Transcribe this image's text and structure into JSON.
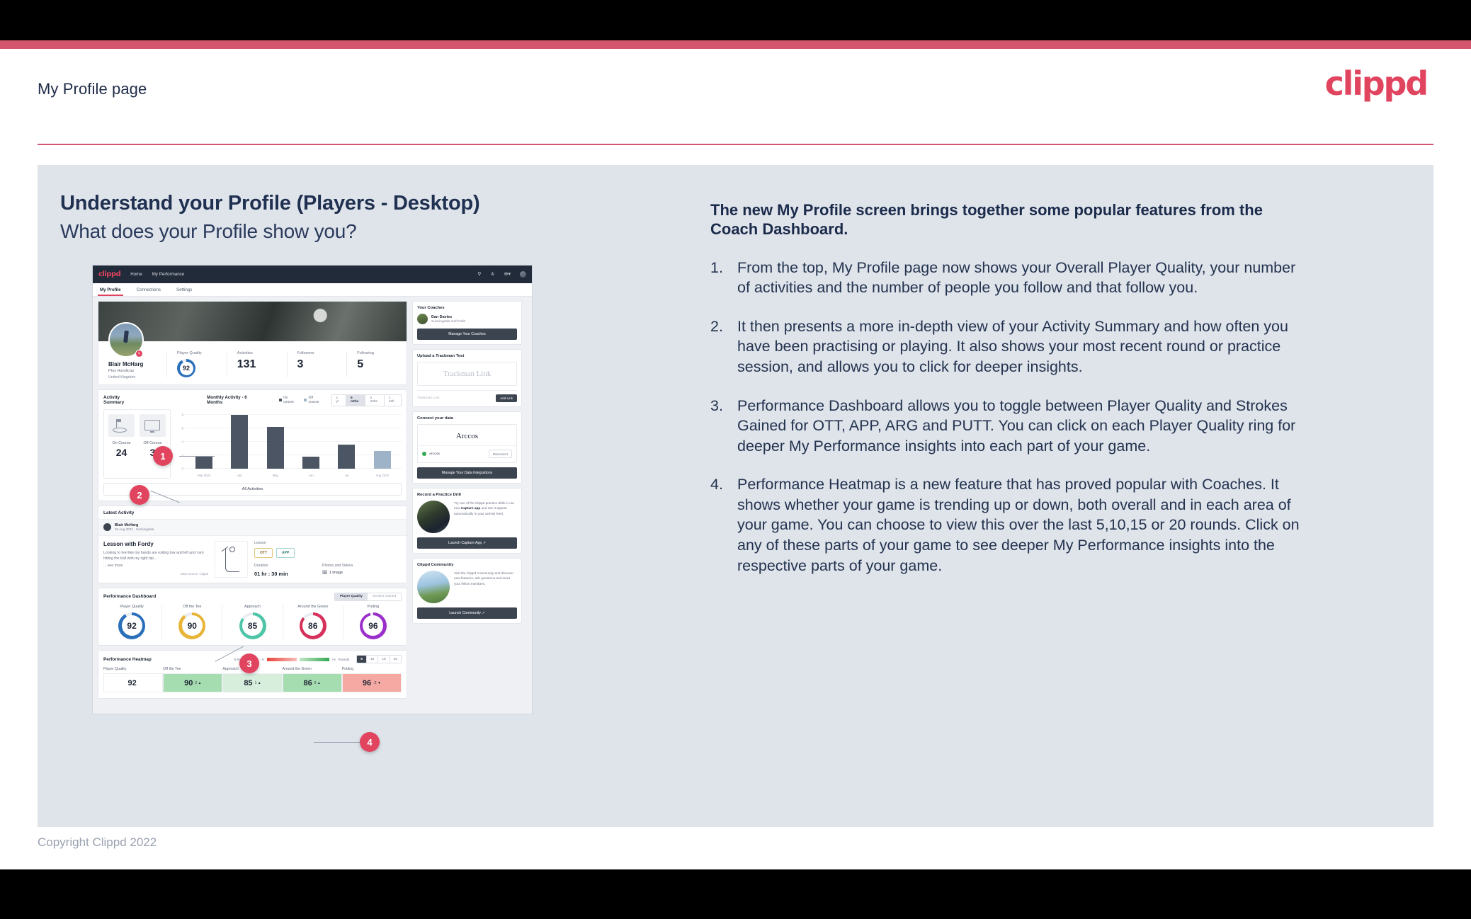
{
  "slide": {
    "header_title": "My Profile page",
    "logo_text": "clippd",
    "headline": "Understand your Profile (Players - Desktop)",
    "subhead": "What does your Profile show you?",
    "copyright": "Copyright Clippd 2022",
    "accent_pink": "#d4556e",
    "panel_bg": "#dfe3ea",
    "text_navy": "#1f3050"
  },
  "explainer": {
    "lead": "The new My Profile screen brings together some popular features from the Coach Dashboard.",
    "items": [
      {
        "num": "1.",
        "text": "From the top, My Profile page now shows your Overall Player Quality, your number of activities and the number of people you follow and that follow you."
      },
      {
        "num": "2.",
        "text": "It then presents a more in-depth view of your Activity Summary and how often you have been practising or playing. It also shows your most recent round or practice session, and allows you to click for deeper insights."
      },
      {
        "num": "3.",
        "text": "Performance Dashboard allows you to toggle between Player Quality and Strokes Gained for OTT, APP, ARG and PUTT. You can click on each Player Quality ring for deeper My Performance insights into each part of your game."
      },
      {
        "num": "4.",
        "text": "Performance Heatmap is a new feature that has proved popular with Coaches. It shows whether your game is trending up or down, both overall and in each area of your game. You can choose to view this over the last 5,10,15 or 20 rounds. Click on any of these parts of your game to see deeper My Performance insights into the respective parts of your game."
      }
    ]
  },
  "markers": [
    "1",
    "2",
    "3",
    "4"
  ],
  "app": {
    "nav": {
      "logo": "clippd",
      "links": [
        "Home",
        "My Performance"
      ],
      "icons": [
        "search-icon",
        "community-icon",
        "add-icon",
        "avatar-icon"
      ]
    },
    "tabs": [
      {
        "label": "My Profile",
        "active": true
      },
      {
        "label": "Connections",
        "active": false
      },
      {
        "label": "Settings",
        "active": false
      }
    ],
    "profile": {
      "name": "Blair McHarg",
      "handicap": "Plus Handicap",
      "location": "United Kingdom",
      "stats": [
        {
          "label": "Player Quality",
          "value": "92",
          "is_ring": true
        },
        {
          "label": "Activities",
          "value": "131",
          "is_ring": false
        },
        {
          "label": "Followers",
          "value": "3",
          "is_ring": false
        },
        {
          "label": "Following",
          "value": "5",
          "is_ring": false
        }
      ]
    },
    "activity_summary": {
      "title": "Activity Summary",
      "chart_title": "Monthly Activity - 6 Months",
      "legend": [
        "On course",
        "Off course"
      ],
      "ranges": [
        "1 yr",
        "6 mths",
        "3 mths",
        "1 mth"
      ],
      "selected_range": "6 mths",
      "on_course_label": "On Course",
      "off_course_label": "Off Course",
      "on_course_value": "24",
      "off_course_value": "3",
      "all_activities_label": "All Activities"
    },
    "latest_activity": {
      "section_title": "Latest Activity",
      "user_name": "Blair McHarg",
      "user_meta": "03 Aug 2022 - Sunningdale",
      "title": "Lesson with Fordy",
      "description": "Looking to feel like my hands are exiting low and left and I am hitting the ball with my right hip...",
      "see_more": "... see more",
      "data_source": "Data Source: Clippd",
      "type_label": "Lesson",
      "chips": [
        "OTT",
        "APP"
      ],
      "duration_label": "Duration",
      "duration_value": "01 hr : 30 min",
      "media_label": "Photos and Videos",
      "media_value": "1 image"
    },
    "performance_dashboard": {
      "title": "Performance Dashboard",
      "toggle": [
        "Player Quality",
        "Strokes Gained"
      ],
      "toggle_selected": "Player Quality",
      "rings": [
        {
          "label": "Player Quality",
          "value": "92",
          "color": "#2a6fba",
          "pct": 92
        },
        {
          "label": "Off the Tee",
          "value": "90",
          "color": "#e8b437",
          "pct": 90
        },
        {
          "label": "Approach",
          "value": "85",
          "color": "#4fc5a8",
          "pct": 85
        },
        {
          "label": "Around the Green",
          "value": "86",
          "color": "#d6315a",
          "pct": 86
        },
        {
          "label": "Putting",
          "value": "96",
          "color": "#9b2fc9",
          "pct": 96
        }
      ]
    },
    "performance_heatmap": {
      "title": "Performance Heatmap",
      "scale_label": "5 Round Change",
      "scale_min": "-5",
      "scale_max": "+5",
      "rounds_label": "Rounds",
      "rounds": [
        "5",
        "10",
        "15",
        "20"
      ],
      "rounds_selected": "5",
      "cells": [
        {
          "label": "Player Quality",
          "value": "92",
          "delta": "",
          "bg": "#ffffff"
        },
        {
          "label": "Off the Tee",
          "value": "90",
          "delta": "2 ▲",
          "bg": "#a5dcb0"
        },
        {
          "label": "Approach",
          "value": "85",
          "delta": "1 ▲",
          "bg": "#d7eedd"
        },
        {
          "label": "Around the Green",
          "value": "86",
          "delta": "2 ▲",
          "bg": "#a5dcb0"
        },
        {
          "label": "Putting",
          "value": "96",
          "delta": "-2 ▼",
          "bg": "#f5a9a2"
        }
      ]
    },
    "sidebar": {
      "coaches": {
        "title": "Your Coaches",
        "coach_name": "Dan Davies",
        "coach_club": "Sunningdale Golf Club",
        "button": "Manage Your Coaches"
      },
      "trackman": {
        "title": "Upload a Trackman Test",
        "brand": "Trackman Link",
        "placeholder": "Trackman Link",
        "button": "Add Link"
      },
      "data": {
        "title": "Connect your data",
        "brand": "Arccos",
        "status_name": "Arccos",
        "status_button": "Disconnect",
        "button": "Manage Your Data Integrations"
      },
      "drill": {
        "title": "Record a Practice Drill",
        "text_1": "Try one of the Clippd practice drills in our new ",
        "text_b": "Capture app",
        "text_2": " and see it appear automatically in your activity feed.",
        "button": "Launch Capture App"
      },
      "community": {
        "title": "Clippd Community",
        "text": "Visit the Clippd Community and discover new features, ask questions and meet your fellow members.",
        "button": "Launch Community"
      }
    }
  },
  "chart_data": {
    "type": "bar",
    "title": "Monthly Activity - 6 Months",
    "categories": [
      "Mar 2022",
      "Apr",
      "May",
      "Jun",
      "Jul",
      "Aug 2022"
    ],
    "values": [
      2,
      9,
      7,
      2,
      4,
      3
    ],
    "series": [
      {
        "name": "On course",
        "values": [
          2,
          9,
          7,
          2,
          4,
          null
        ],
        "color": "#4b5563"
      },
      {
        "name": "Off course",
        "values": [
          null,
          null,
          null,
          null,
          null,
          3
        ],
        "color": "#9fb3c8"
      }
    ],
    "xlabel": "",
    "ylabel": "",
    "ylim": [
      0,
      10
    ],
    "yticks": [
      0,
      2,
      4,
      6,
      8
    ],
    "grid": true,
    "legend": "top-right"
  }
}
